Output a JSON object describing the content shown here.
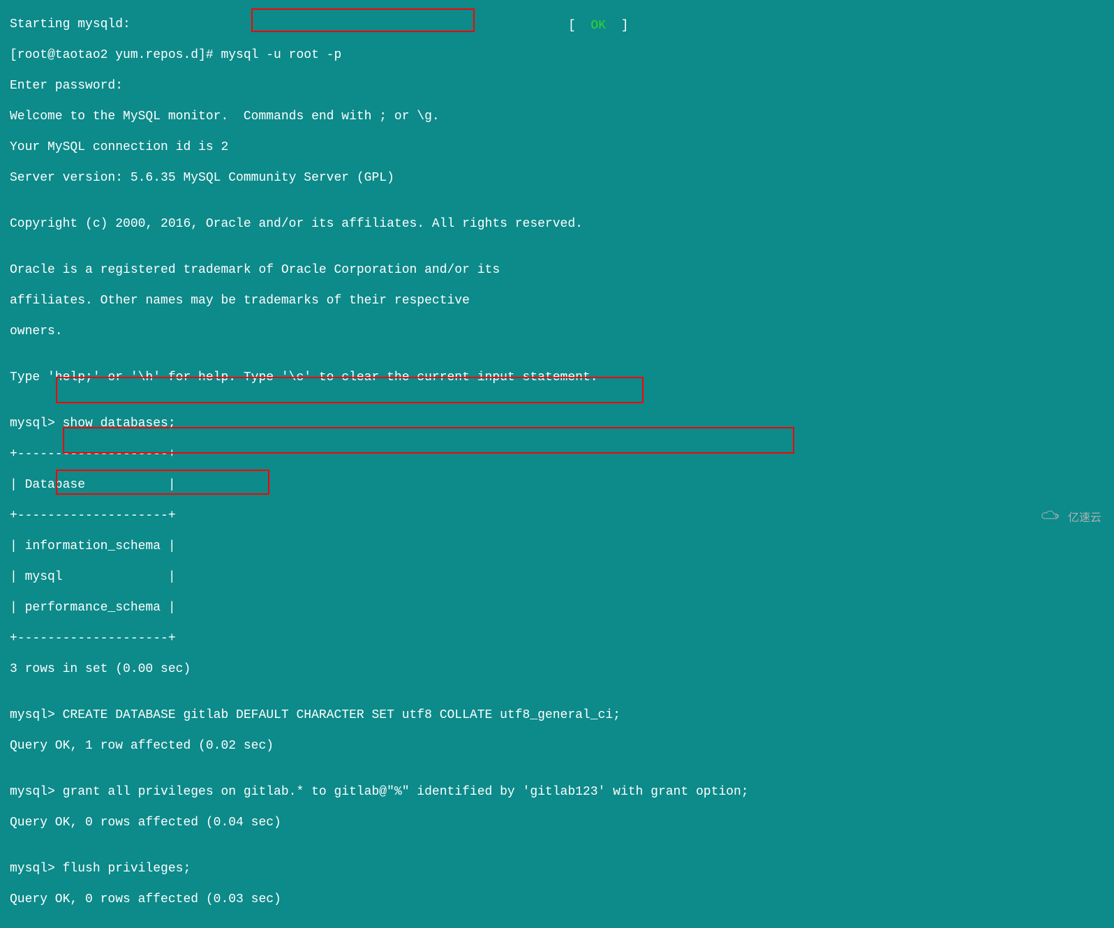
{
  "status": {
    "lbracket": "[  ",
    "ok": "OK",
    "rbracket": "  ]"
  },
  "terminal": {
    "l1": "Starting mysqld:",
    "l2": "[root@taotao2 yum.repos.d]# mysql -u root -p",
    "l3": "Enter password:",
    "l4": "Welcome to the MySQL monitor.  Commands end with ; or \\g.",
    "l5": "Your MySQL connection id is 2",
    "l6": "Server version: 5.6.35 MySQL Community Server (GPL)",
    "l7": "",
    "l8": "Copyright (c) 2000, 2016, Oracle and/or its affiliates. All rights reserved.",
    "l9": "",
    "l10": "Oracle is a registered trademark of Oracle Corporation and/or its",
    "l11": "affiliates. Other names may be trademarks of their respective",
    "l12": "owners.",
    "l13": "",
    "l14": "Type 'help;' or '\\h' for help. Type '\\c' to clear the current input statement.",
    "l15": "",
    "l16": "mysql> show databases;",
    "l17": "+--------------------+",
    "l18": "| Database           |",
    "l19": "+--------------------+",
    "l20": "| information_schema |",
    "l21": "| mysql              |",
    "l22": "| performance_schema |",
    "l23": "+--------------------+",
    "l24": "3 rows in set (0.00 sec)",
    "l25": "",
    "l26": "mysql> CREATE DATABASE gitlab DEFAULT CHARACTER SET utf8 COLLATE utf8_general_ci;",
    "l27": "Query OK, 1 row affected (0.02 sec)",
    "l28": "",
    "l29": "mysql> grant all privileges on gitlab.* to gitlab@\"%\" identified by 'gitlab123' with grant option;",
    "l30": "Query OK, 0 rows affected (0.04 sec)",
    "l31": "",
    "l32": "mysql> flush privileges;",
    "l33": "Query OK, 0 rows affected (0.03 sec)"
  },
  "watermark": {
    "text": "亿速云"
  }
}
